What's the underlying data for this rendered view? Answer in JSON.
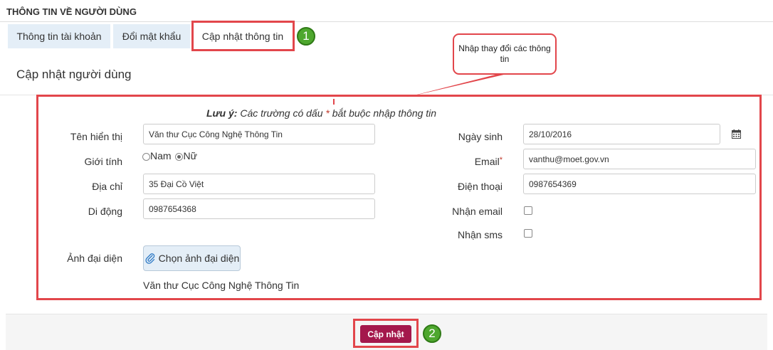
{
  "header": {
    "title": "THÔNG TIN VỀ NGƯỜI DÙNG"
  },
  "tabs": [
    {
      "label": "Thông tin tài khoản"
    },
    {
      "label": "Đổi mật khẩu"
    },
    {
      "label": "Cập nhật thông tin"
    }
  ],
  "badges": {
    "one": "1",
    "two": "2"
  },
  "callout": {
    "text": "Nhập thay đổi các thông tin"
  },
  "section": {
    "title": "Cập nhật người dùng"
  },
  "note": {
    "prefix": "Lưu ý:",
    "text": " Các trường có dấu ",
    "star": "*",
    "suffix": " bắt buộc nhập thông tin"
  },
  "form": {
    "display_name": {
      "label": "Tên hiển thị",
      "value": "Văn thư Cục Công Nghệ Thông Tin"
    },
    "gender": {
      "label": "Giới tính",
      "options": [
        "Nam",
        "Nữ"
      ],
      "selected": "Nữ"
    },
    "address": {
      "label": "Địa chỉ",
      "value": "35 Đại Cồ Việt"
    },
    "mobile": {
      "label": "Di động",
      "value": "0987654368"
    },
    "birthday": {
      "label": "Ngày sinh",
      "value": "28/10/2016"
    },
    "email": {
      "label": "Email",
      "star": "*",
      "value": "vanthu@moet.gov.vn"
    },
    "phone": {
      "label": "Điện thoại",
      "value": "0987654369"
    },
    "receive_email": {
      "label": "Nhận email",
      "checked": false
    },
    "receive_sms": {
      "label": "Nhận sms",
      "checked": false
    },
    "avatar": {
      "label": "Ảnh đại diện",
      "button_label": "Chọn ảnh đại diện",
      "caption": "Văn thư Cục Công Nghệ Thông Tin"
    }
  },
  "footer": {
    "submit_label": "Cập nhật"
  },
  "colors": {
    "highlight": "#e2464b",
    "badge": "#4ea72e",
    "submit": "#a4184c",
    "tab": "#e4eef7"
  },
  "icons": [
    "calendar-icon",
    "paperclip-icon"
  ]
}
